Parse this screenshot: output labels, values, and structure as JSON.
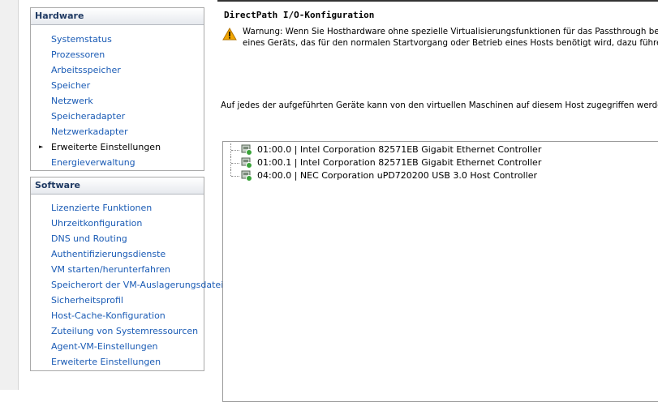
{
  "hardware": {
    "title": "Hardware",
    "items": [
      {
        "label": "Systemstatus"
      },
      {
        "label": "Prozessoren"
      },
      {
        "label": "Arbeitsspeicher"
      },
      {
        "label": "Speicher"
      },
      {
        "label": "Netzwerk"
      },
      {
        "label": "Speicheradapter"
      },
      {
        "label": "Netzwerkadapter"
      },
      {
        "label": "Erweiterte Einstellungen",
        "active": true
      },
      {
        "label": "Energieverwaltung"
      }
    ]
  },
  "software": {
    "title": "Software",
    "items": [
      {
        "label": "Lizenzierte Funktionen"
      },
      {
        "label": "Uhrzeitkonfiguration"
      },
      {
        "label": "DNS und Routing"
      },
      {
        "label": "Authentifizierungsdienste"
      },
      {
        "label": "VM starten/herunterfahren"
      },
      {
        "label": "Speicherort der VM-Auslagerungsdatei"
      },
      {
        "label": "Sicherheitsprofil"
      },
      {
        "label": "Host-Cache-Konfiguration"
      },
      {
        "label": "Zuteilung von Systemressourcen"
      },
      {
        "label": "Agent-VM-Einstellungen"
      },
      {
        "label": "Erweiterte Einstellungen"
      }
    ]
  },
  "main": {
    "title": "DirectPath I/O-Konfiguration",
    "warning_icon": "warning-icon",
    "warning_line1": "Warnung: Wenn Sie Hosthardware ohne spezielle Virtualisierungsfunktionen für das Passthrough bei virtue",
    "warning_line2": "eines Geräts, das für den normalen Startvorgang oder Betrieb eines Hosts benötigt wird, dazu führen, das",
    "access_note": "Auf jedes der aufgeführten Geräte kann von den virtuellen Maschinen auf diesem Host zugegriffen werden.",
    "devices": [
      {
        "label": "01:00.0 | Intel Corporation 82571EB Gigabit Ethernet Controller"
      },
      {
        "label": "01:00.1 | Intel Corporation 82571EB Gigabit Ethernet Controller"
      },
      {
        "label": "04:00.0 | NEC Corporation uPD720200 USB 3.0 Host Controller"
      }
    ]
  },
  "colors": {
    "link": "#1a5bb5",
    "header_text": "#1f3a63",
    "warning": "#f2a600",
    "device_ok": "#3aa43a"
  }
}
